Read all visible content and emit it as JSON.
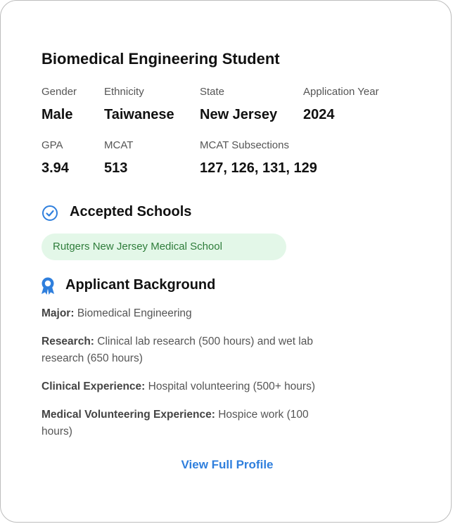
{
  "profile": {
    "title": "Biomedical Engineering Student",
    "gender_label": "Gender",
    "gender": "Male",
    "ethnicity_label": "Ethnicity",
    "ethnicity": "Taiwanese",
    "state_label": "State",
    "state": "New Jersey",
    "app_year_label": "Application Year",
    "app_year": "2024",
    "gpa_label": "GPA",
    "gpa": "3.94",
    "mcat_label": "MCAT",
    "mcat": "513",
    "mcat_sub_label": "MCAT Subsections",
    "mcat_sub": "127, 126, 131, 129"
  },
  "accepted": {
    "heading": "Accepted Schools",
    "schools": [
      "Rutgers New Jersey Medical School"
    ],
    "icon": "check-circle-icon",
    "icon_color": "#2f7fdd",
    "pill_bg": "#e3f7e8",
    "pill_text_color": "#2e7d3a"
  },
  "background": {
    "heading": "Applicant Background",
    "icon": "award-ribbon-icon",
    "icon_color": "#2f7fdd",
    "major_label": "Major:",
    "major": "Biomedical Engineering",
    "research_label": "Research:",
    "research": "Clinical lab research (500 hours) and wet lab research (650 hours)",
    "clinical_label": "Clinical Experience:",
    "clinical": "Hospital volunteering (500+ hours)",
    "volunteer_label": "Medical Volunteering Experience:",
    "volunteer": "Hospice work (100 hours)"
  },
  "actions": {
    "view_full_profile": "View Full Profile",
    "link_color": "#2f7fdd"
  }
}
